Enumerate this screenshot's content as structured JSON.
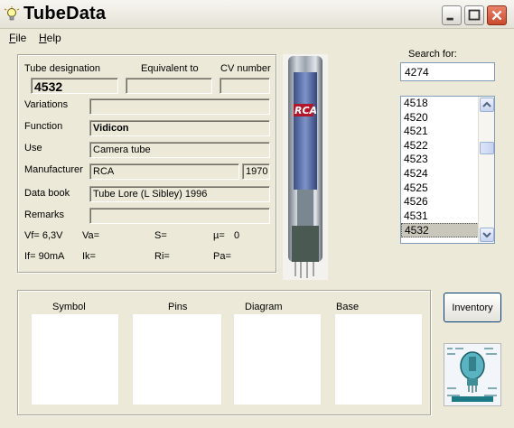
{
  "window": {
    "title": "TubeData",
    "controls": [
      "minimize",
      "maximize",
      "close"
    ]
  },
  "menu": {
    "file": {
      "accel": "F",
      "rest": "ile"
    },
    "help": {
      "accel": "H",
      "rest": "elp"
    }
  },
  "details": {
    "tube_designation_label": "Tube designation",
    "tube_designation": "4532",
    "equivalent_label": "Equivalent to",
    "equivalent": "",
    "cv_label": "CV number",
    "cv": "",
    "variations_label": "Variations",
    "variations": "",
    "function_label": "Function",
    "function": "Vidicon",
    "use_label": "Use",
    "use": "Camera tube",
    "manufacturer_label": "Manufacturer",
    "manufacturer": "RCA",
    "year": "1970",
    "databook_label": "Data book",
    "databook": "Tube Lore (L Sibley) 1996",
    "remarks_label": "Remarks",
    "remarks": "",
    "vf": "Vf= 6,3V",
    "va": "Va=",
    "s": "S=",
    "mu": "µ=",
    "mu_value": "0",
    "if": "If= 90mA",
    "ik": "Ik=",
    "ri": "Ri=",
    "pa": "Pa="
  },
  "search": {
    "label": "Search for:",
    "value": "4274",
    "items": [
      "4518",
      "4520",
      "4521",
      "4522",
      "4523",
      "4524",
      "4525",
      "4526",
      "4531",
      "4532"
    ],
    "selected": "4532"
  },
  "panels": {
    "symbol": "Symbol",
    "pins": "Pins",
    "diagram": "Diagram",
    "base": "Base"
  },
  "inventory_label": "Inventory",
  "colors": {
    "bg": "#ece9d8",
    "close": "#c94a2c",
    "field_border": "#7f9db9",
    "selection": "#c9c7bb"
  }
}
